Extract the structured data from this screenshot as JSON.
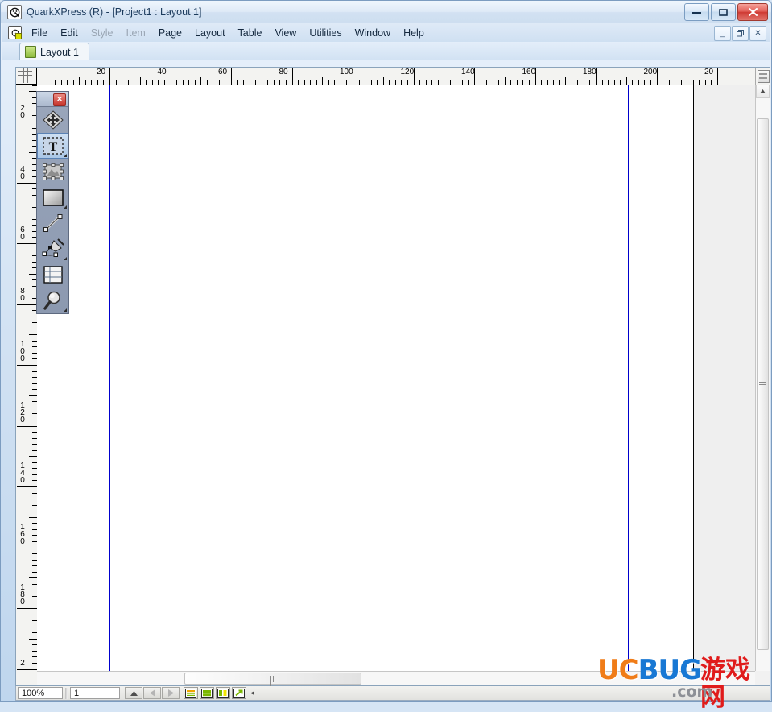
{
  "window": {
    "title": "QuarkXPress (R) - [Project1 : Layout 1]",
    "app_icon": "quark-icon",
    "minimize_label": "—",
    "maximize_label": "□",
    "close_label": "✕"
  },
  "mdi": {
    "minimize_label": "_",
    "restore_label": "❐",
    "close_label": "✕"
  },
  "menu": {
    "items": [
      {
        "label": "File",
        "disabled": false
      },
      {
        "label": "Edit",
        "disabled": false
      },
      {
        "label": "Style",
        "disabled": true
      },
      {
        "label": "Item",
        "disabled": true
      },
      {
        "label": "Page",
        "disabled": false
      },
      {
        "label": "Layout",
        "disabled": false
      },
      {
        "label": "Table",
        "disabled": false
      },
      {
        "label": "View",
        "disabled": false
      },
      {
        "label": "Utilities",
        "disabled": false
      },
      {
        "label": "Window",
        "disabled": false
      },
      {
        "label": "Help",
        "disabled": false
      }
    ]
  },
  "tabs": [
    {
      "label": "Layout 1",
      "icon": "page-icon",
      "active": true
    }
  ],
  "tools": {
    "title": "tools-palette",
    "close_label": "✕",
    "items": [
      {
        "name": "item-move-tool",
        "label": "Item Tool",
        "selected": false,
        "popup": false
      },
      {
        "name": "text-box-tool",
        "label": "Text Box Tool",
        "selected": true,
        "popup": true
      },
      {
        "name": "picture-box-tool",
        "label": "Picture Box Tool",
        "selected": false,
        "popup": false
      },
      {
        "name": "rectangle-box-tool",
        "label": "Rectangle Box Tool",
        "selected": false,
        "popup": true
      },
      {
        "name": "line-tool",
        "label": "Line Tool",
        "selected": false,
        "popup": false
      },
      {
        "name": "bezier-pen-tool",
        "label": "Bezier Pen Tool",
        "selected": false,
        "popup": true
      },
      {
        "name": "table-tool",
        "label": "Table Tool",
        "selected": false,
        "popup": false
      },
      {
        "name": "zoom-tool",
        "label": "Zoom Tool",
        "selected": false,
        "popup": true
      }
    ]
  },
  "rulers": {
    "units": "mm",
    "horizontal_labels": [
      "20",
      "40",
      "60",
      "80",
      "100",
      "120",
      "140",
      "160",
      "180",
      "200",
      "20"
    ],
    "vertical_labels": [
      "20",
      "40",
      "60",
      "80",
      "100",
      "120",
      "140",
      "160",
      "180",
      "2"
    ]
  },
  "statusbar": {
    "zoom_value": "100%",
    "zoom_placeholder": "100%",
    "page_value": "1",
    "page_placeholder": "1",
    "nav_up_label": "▲",
    "nav_prev_label": "◀",
    "nav_next_label": "▶",
    "view_buttons": [
      {
        "name": "single-page-view-button",
        "label": "single-page-view-icon"
      },
      {
        "name": "split-horizontal-view-button",
        "label": "split-horizontal-icon"
      },
      {
        "name": "split-vertical-view-button",
        "label": "split-vertical-icon"
      },
      {
        "name": "expand-view-button",
        "label": "expand-arrow-icon"
      }
    ],
    "splitter_label": "◂"
  },
  "scrollbars": {
    "v_up_label": "▲",
    "v_down_label": "▼",
    "h_left_label": "◀",
    "h_right_label": "▶"
  },
  "watermark": {
    "uc": "UC",
    "bug": "BUG",
    "chinese": "游戏网",
    "com": ".com"
  },
  "colors": {
    "guide": "#0000cd",
    "page": "#ffffff",
    "pasteboard": "#efefef",
    "accent": "#1878d4",
    "close_red": "#cf3a33"
  }
}
